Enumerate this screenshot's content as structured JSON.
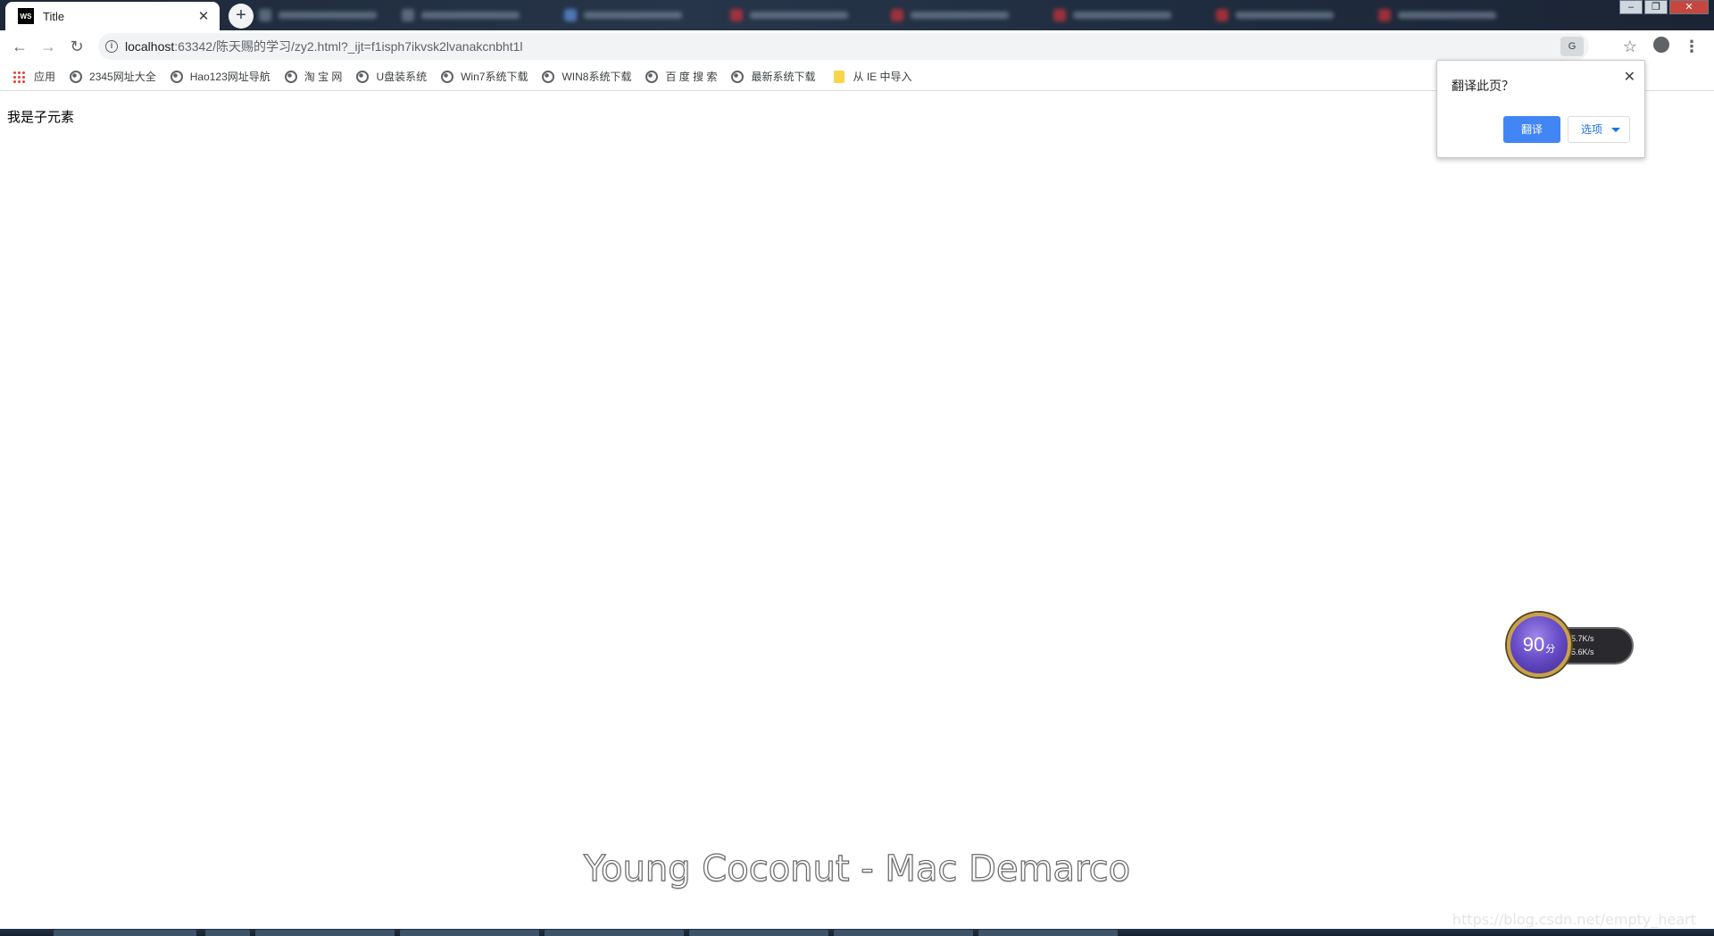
{
  "browser": {
    "active_tab": {
      "title": "Title",
      "favicon": "WS"
    },
    "url": {
      "host": "localhost",
      "rest": ":63342/陈天赐的学习/zy2.html?_ijt=f1isph7ikvsk2lvanakcnbht1l"
    },
    "bookmarks": [
      {
        "label": "应用",
        "icon": "apps-icon"
      },
      {
        "label": "2345网址大全",
        "icon": "globe-icon"
      },
      {
        "label": "Hao123网址导航",
        "icon": "globe-icon"
      },
      {
        "label": "淘 宝 网",
        "icon": "globe-icon"
      },
      {
        "label": "U盘装系统",
        "icon": "globe-icon"
      },
      {
        "label": "Win7系统下载",
        "icon": "globe-icon"
      },
      {
        "label": "WIN8系统下载",
        "icon": "globe-icon"
      },
      {
        "label": "百 度 搜 索",
        "icon": "globe-icon"
      },
      {
        "label": "最新系统下载",
        "icon": "globe-icon"
      },
      {
        "label": "从 IE 中导入",
        "icon": "folder-icon"
      }
    ]
  },
  "page": {
    "text": "我是子元素"
  },
  "translate_popup": {
    "title": "翻译此页？",
    "translate_label": "翻译",
    "options_label": "选项"
  },
  "speed_widget": {
    "score": "90",
    "score_unit": "分",
    "upload": "5.7K/s",
    "download": "5.6K/s"
  },
  "overlay": {
    "lyric": "Young Coconut - Mac Demarco",
    "watermark": "https://blog.csdn.net/empty_heart"
  },
  "colors": {
    "accent": "#4285f4",
    "tabstrip": "#1e2a3a"
  }
}
